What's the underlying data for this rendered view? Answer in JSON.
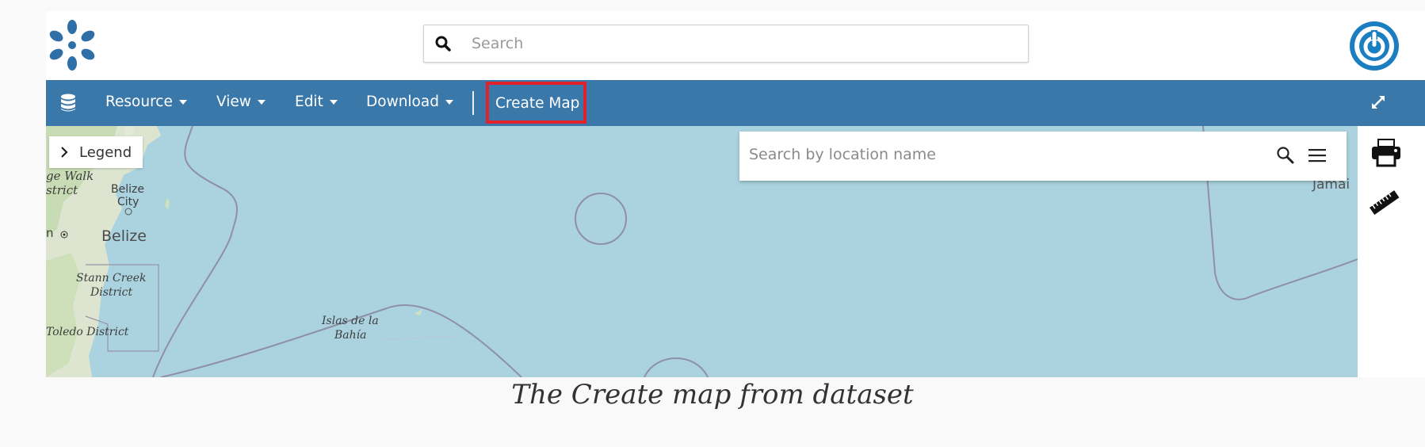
{
  "header": {
    "search_placeholder": "Search",
    "logo_icon": "geonode-logo-icon",
    "power_icon": "power-icon",
    "accent_color": "#1a7ec1"
  },
  "toolbar": {
    "background": "#3b78aa",
    "items": [
      {
        "label": "Resource"
      },
      {
        "label": "View"
      },
      {
        "label": "Edit"
      },
      {
        "label": "Download"
      }
    ],
    "create_map_label": "Create Map",
    "highlight_color": "#e1222c"
  },
  "map": {
    "legend_label": "Legend",
    "location_search_placeholder": "Search by location name",
    "labels": {
      "ge_walk": "ge Walk",
      "strict": "strict",
      "belize_city_1": "Belize",
      "belize_city_2": "City",
      "belize": "Belize",
      "n": "n",
      "stann_creek_1": "Stann Creek",
      "stann_creek_2": "District",
      "toledo": "Toledo District",
      "islas_1": "Islas de la",
      "islas_2": "Bahía",
      "jamaica": "Jamai"
    }
  },
  "caption": "The Create map from dataset"
}
